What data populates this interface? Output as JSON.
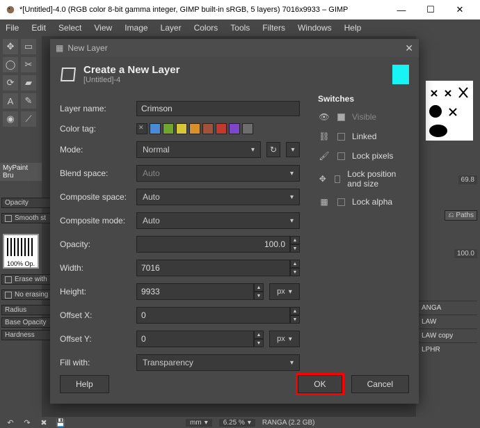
{
  "window": {
    "title": "*[Untitled]-4.0 (RGB color 8-bit gamma integer, GIMP built-in sRGB, 5 layers) 7016x9933 – GIMP"
  },
  "menubar": [
    "File",
    "Edit",
    "Select",
    "View",
    "Image",
    "Layer",
    "Colors",
    "Tools",
    "Filters",
    "Windows",
    "Help"
  ],
  "left": {
    "mypaint_tab": "MyPaint Bru",
    "opacity": "Opacity",
    "smooth": "Smooth st",
    "brush_label": "100% Op.",
    "erase": "Erase with",
    "noerase": "No erasing",
    "radius": "Radius",
    "baseop": "Base Opacity",
    "hardness": "Hardness"
  },
  "right": {
    "size": "69.8",
    "paths": "Paths",
    "hundred": "100.0",
    "layers": [
      "ANGA",
      "LAW",
      "LAW copy",
      "LPHR"
    ]
  },
  "dialog": {
    "title": "New Layer",
    "heading": "Create a New Layer",
    "subtitle": "[Untitled]-4",
    "labels": {
      "layer_name": "Layer name:",
      "color_tag": "Color tag:",
      "mode": "Mode:",
      "blend_space": "Blend space:",
      "composite_space": "Composite space:",
      "composite_mode": "Composite mode:",
      "opacity": "Opacity:",
      "width": "Width:",
      "height": "Height:",
      "offset_x": "Offset X:",
      "offset_y": "Offset Y:",
      "fill_with": "Fill with:"
    },
    "values": {
      "layer_name": "Crimson",
      "mode": "Normal",
      "blend_space": "Auto",
      "composite_space": "Auto",
      "composite_mode": "Auto",
      "opacity": "100.0",
      "width": "7016",
      "height": "9933",
      "offset_x": "0",
      "offset_y": "0",
      "unit": "px",
      "fill_with": "Transparency"
    },
    "switches_h": "Switches",
    "switches": {
      "visible": "Visible",
      "linked": "Linked",
      "lock_pixels": "Lock pixels",
      "lock_pos": "Lock position and size",
      "lock_alpha": "Lock alpha"
    },
    "buttons": {
      "help": "Help",
      "ok": "OK",
      "cancel": "Cancel"
    }
  },
  "status": {
    "unit": "mm",
    "zoom": "6.25 %",
    "layer_info": "RANGA (2.2 GB)"
  },
  "color_tags": [
    "#3a3a3a",
    "#4b8bd6",
    "#6fa62e",
    "#d8c63a",
    "#d8902a",
    "#a0533a",
    "#c13a2e",
    "#7e46c9",
    "#6d6d6d"
  ]
}
